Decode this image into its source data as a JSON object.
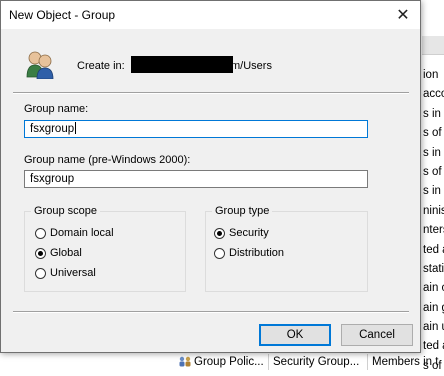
{
  "dialog": {
    "title": "New Object - Group",
    "close_glyph": "✕",
    "create_in_label": "Create in:",
    "create_in_path_suffix": "m/Users",
    "group_name_label": "Group name:",
    "group_name_value": "fsxgroup",
    "group_name_pre2000_label": "Group name (pre-Windows 2000):",
    "group_name_pre2000_value": "fsxgroup",
    "group_scope": {
      "legend": "Group scope",
      "options": [
        "Domain local",
        "Global",
        "Universal"
      ],
      "selected": "Global"
    },
    "group_type": {
      "legend": "Group type",
      "options": [
        "Security",
        "Distribution"
      ],
      "selected": "Security"
    },
    "ok_label": "OK",
    "cancel_label": "Cancel",
    "icon": "users-group-icon"
  },
  "background": {
    "column_fragments": [
      "ion",
      "acco",
      "s in t",
      "s of",
      "s in t",
      "s of",
      "s in t",
      "ninis",
      "nters w",
      "ted a",
      "statio",
      "ain c",
      "ain g",
      "ain u",
      "ted a",
      "s of",
      "s of"
    ],
    "bottom_row": {
      "type": "Group Polic...",
      "group": "Security Group...",
      "desc": "Members in t"
    }
  }
}
